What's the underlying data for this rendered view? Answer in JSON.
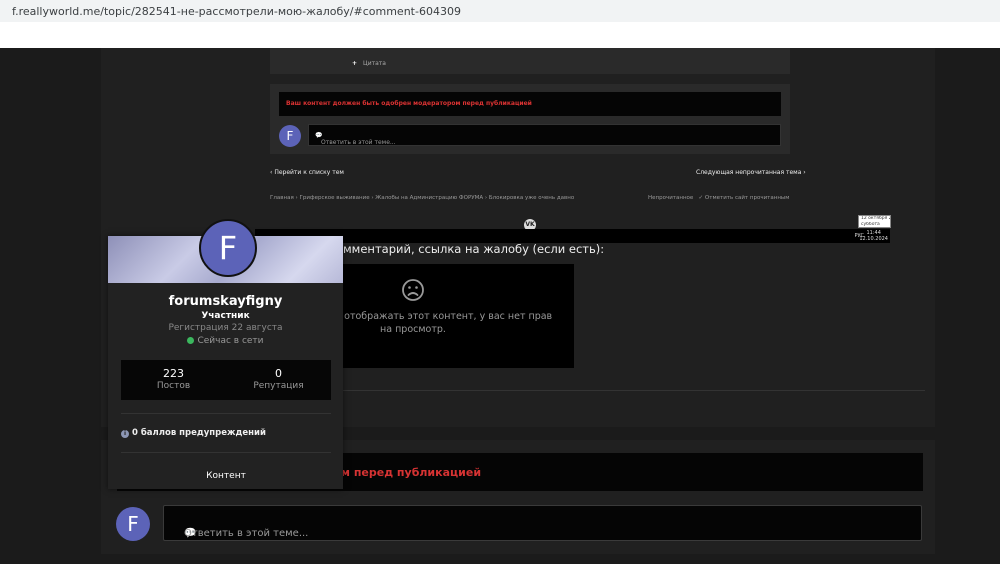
{
  "browser": {
    "url": "f.reallyworld.me/topic/282541-не-рассмотрели-мою-жалобу/#comment-604309"
  },
  "inner_screenshot": {
    "quote_label": "Цитата",
    "warning": "Ваш контент должен быть одобрен модератором перед публикацией",
    "avatar_letter": "F",
    "reply_placeholder": "Ответить в этой теме...",
    "nav_prev": "Перейти к списку тем",
    "nav_next": "Следующая непрочитанная тема",
    "breadcrumb": [
      "Главная",
      "Гриферское выживание",
      "Жалобы на Администрацию ФОРУМА",
      "Блокировка уже очень давно"
    ],
    "tool_unread": "Непрочитанное",
    "tool_mark_read": "Отметить сайт прочитанным",
    "vk_label": "VK",
    "taskbar_lang": "РУС",
    "taskbar_time": "11:44",
    "taskbar_date": "12.10.2024",
    "tooltip_line1": "12 октября 20",
    "tooltip_line2": "суббота"
  },
  "main": {
    "comment_label": "мментарий, ссылка на жалобу (если есть):",
    "blocked_message": "мы не можем отображать этот контент, у вас нет прав на просмотр.",
    "warning": "м перед публикацией",
    "avatar_letter": "F",
    "reply_placeholder": "Ответить в этой теме..."
  },
  "profile_card": {
    "avatar_letter": "F",
    "username": "forumskayfigny",
    "role": "Участник",
    "registered": "Регистрация 22 августа",
    "status": "Сейчас в сети",
    "stats": [
      {
        "value": "223",
        "label": "Постов"
      },
      {
        "value": "0",
        "label": "Репутация"
      }
    ],
    "warning_points": "0 баллов предупреждений",
    "content_button": "Контент"
  },
  "colors": {
    "accent_avatar": "#5c63b8",
    "warning_red": "#d63333",
    "online_green": "#3bb75e"
  }
}
